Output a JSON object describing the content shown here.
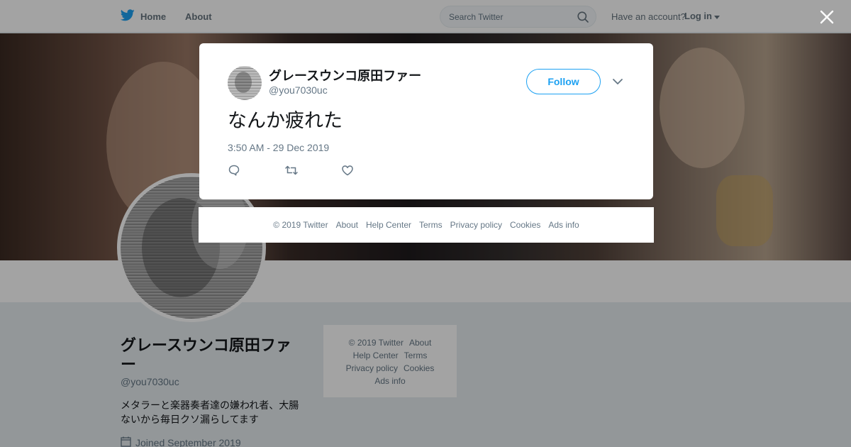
{
  "nav": {
    "home_label": "Home",
    "about_label": "About",
    "search_placeholder": "Search Twitter",
    "have_account": "Have an account?",
    "login_label": "Log in"
  },
  "profile": {
    "name": "グレースウンコ原田ファー",
    "handle": "@you7030uc",
    "bio": "メタラーと楽器奏者達の嫌われ者、大腸ないから毎日クソ漏らしてます",
    "joined": "Joined September 2019"
  },
  "side_footer": {
    "row1": [
      "© 2019 Twitter",
      "About"
    ],
    "row2": [
      "Help Center",
      "Terms"
    ],
    "row3": [
      "Privacy policy",
      "Cookies"
    ],
    "row4": [
      "Ads info"
    ]
  },
  "tweet": {
    "author_name": "グレースウンコ原田ファー",
    "author_handle": "@you7030uc",
    "follow_label": "Follow",
    "text": "なんか疲れた",
    "timestamp": "3:50 AM - 29 Dec 2019"
  },
  "modal_footer": {
    "links": [
      "© 2019 Twitter",
      "About",
      "Help Center",
      "Terms",
      "Privacy policy",
      "Cookies",
      "Ads info"
    ]
  },
  "colors": {
    "accent": "#1da1f2",
    "secondary_text": "#657786",
    "primary_text": "#14171a",
    "overlay": "rgba(0,0,0,0.36)"
  },
  "icons": [
    "twitter-bird-icon",
    "search-icon",
    "caret-down-icon",
    "calendar-icon",
    "close-icon",
    "chevron-down-icon",
    "reply-icon",
    "retweet-icon",
    "like-icon"
  ]
}
